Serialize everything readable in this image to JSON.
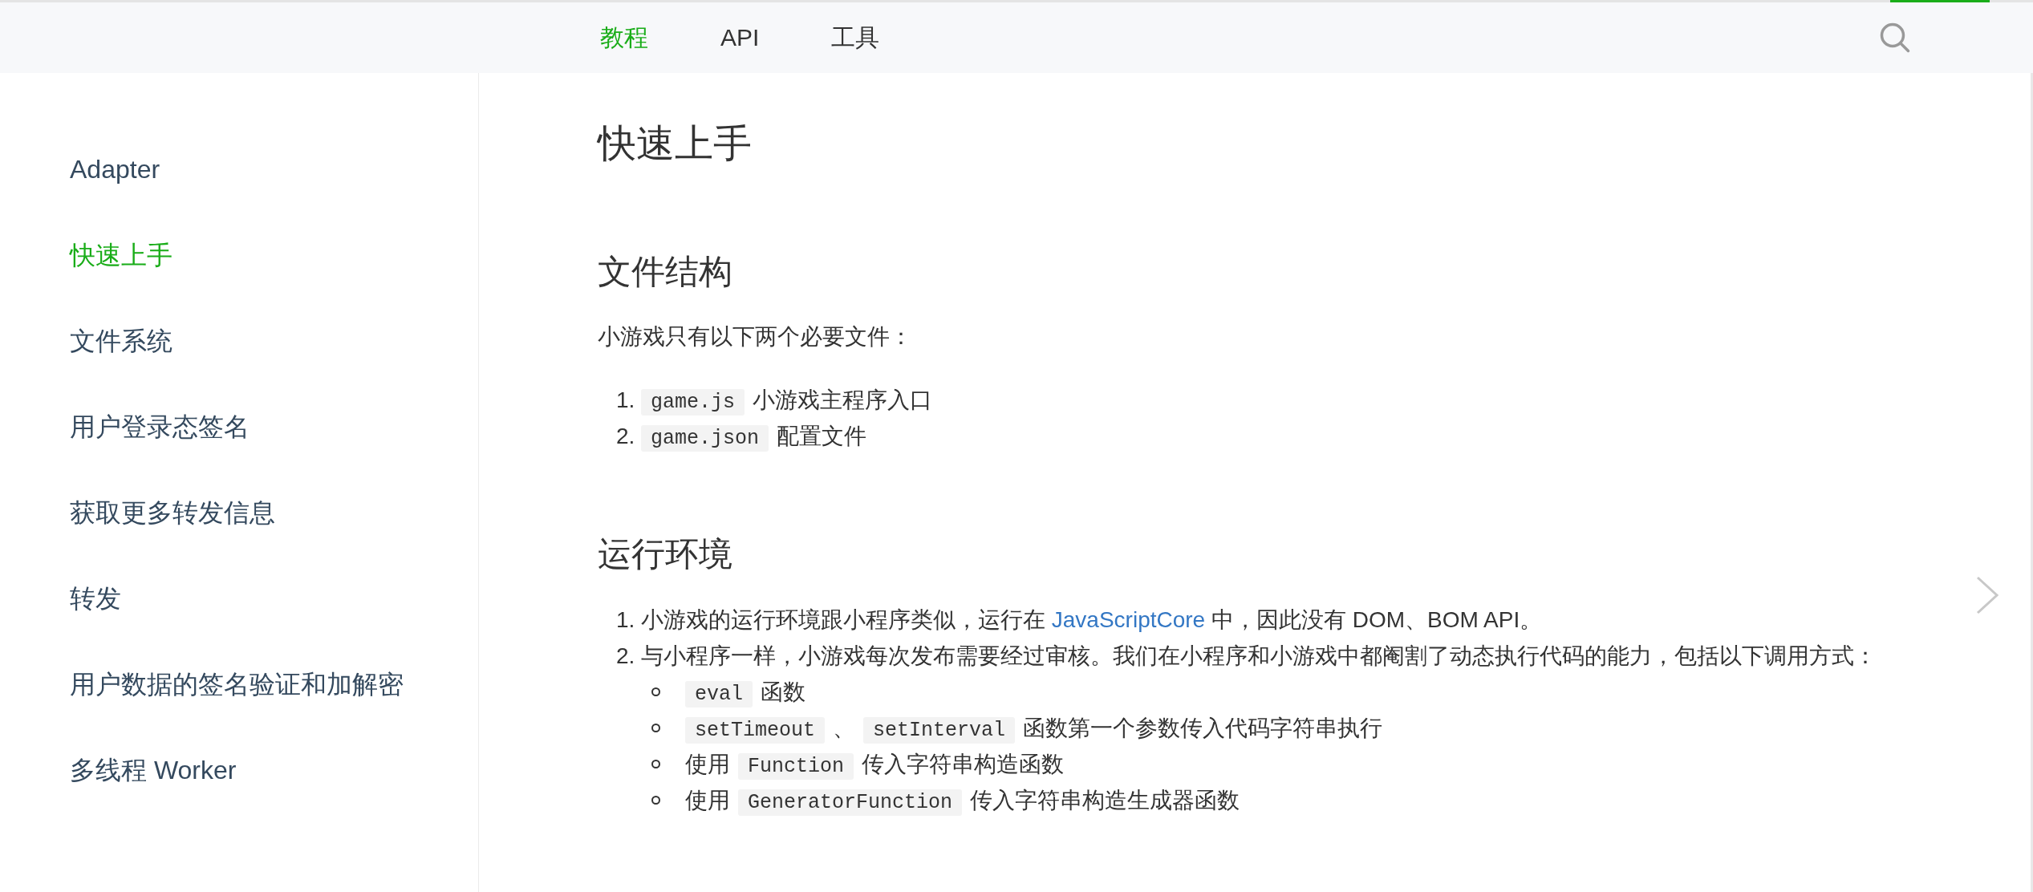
{
  "top_nav": {
    "tabs": [
      {
        "label": "教程",
        "selected": true
      },
      {
        "label": "API",
        "selected": false
      },
      {
        "label": "工具",
        "selected": false
      }
    ]
  },
  "sidebar": {
    "items": [
      {
        "label": "Adapter",
        "selected": false
      },
      {
        "label": "快速上手",
        "selected": true
      },
      {
        "label": "文件系统",
        "selected": false
      },
      {
        "label": "用户登录态签名",
        "selected": false
      },
      {
        "label": "获取更多转发信息",
        "selected": false
      },
      {
        "label": "转发",
        "selected": false
      },
      {
        "label": "用户数据的签名验证和加解密",
        "selected": false
      },
      {
        "label": "多线程 Worker",
        "selected": false
      }
    ]
  },
  "article": {
    "title": "快速上手",
    "sections": [
      {
        "heading": "文件结构",
        "blocks": [
          {
            "kind": "paragraph",
            "parts": [
              {
                "kind": "text",
                "text": "小游戏只有以下两个必要文件："
              }
            ]
          },
          {
            "kind": "ordered_list",
            "items": [
              {
                "number": "1.",
                "parts": [
                  {
                    "kind": "code",
                    "text": "game.js"
                  },
                  {
                    "kind": "text",
                    "text": "小游戏主程序入口"
                  }
                ]
              },
              {
                "number": "2.",
                "parts": [
                  {
                    "kind": "code",
                    "text": "game.json"
                  },
                  {
                    "kind": "text",
                    "text": "配置文件"
                  }
                ]
              }
            ]
          }
        ]
      },
      {
        "heading": "运行环境",
        "blocks": [
          {
            "kind": "ordered_list",
            "items": [
              {
                "number": "1.",
                "parts": [
                  {
                    "kind": "text",
                    "text": "小游戏的运行环境跟小程序类似，运行在 "
                  },
                  {
                    "kind": "link",
                    "text": "JavaScriptCore"
                  },
                  {
                    "kind": "text",
                    "text": " 中，因此没有 DOM、BOM API。"
                  }
                ]
              },
              {
                "number": "2.",
                "parts": [
                  {
                    "kind": "text",
                    "text": "与小程序一样，小游戏每次发布需要经过审核。我们在小程序和小游戏中都阉割了动态执行代码的能力，包括以下调用方式："
                  }
                ],
                "children": [
                  {
                    "parts": [
                      {
                        "kind": "code",
                        "text": "eval"
                      },
                      {
                        "kind": "text",
                        "text": "函数"
                      }
                    ]
                  },
                  {
                    "parts": [
                      {
                        "kind": "code",
                        "text": "setTimeout"
                      },
                      {
                        "kind": "text",
                        "text": "、"
                      },
                      {
                        "kind": "code",
                        "text": "setInterval"
                      },
                      {
                        "kind": "text",
                        "text": "函数第一个参数传入代码字符串执行"
                      }
                    ]
                  },
                  {
                    "parts": [
                      {
                        "kind": "text",
                        "text": "使用"
                      },
                      {
                        "kind": "code",
                        "text": "Function"
                      },
                      {
                        "kind": "text",
                        "text": "传入字符串构造函数"
                      }
                    ]
                  },
                  {
                    "parts": [
                      {
                        "kind": "text",
                        "text": "使用"
                      },
                      {
                        "kind": "code",
                        "text": "GeneratorFunction"
                      },
                      {
                        "kind": "text",
                        "text": "传入字符串构造生成器函数"
                      }
                    ]
                  }
                ]
              }
            ]
          }
        ]
      }
    ]
  }
}
